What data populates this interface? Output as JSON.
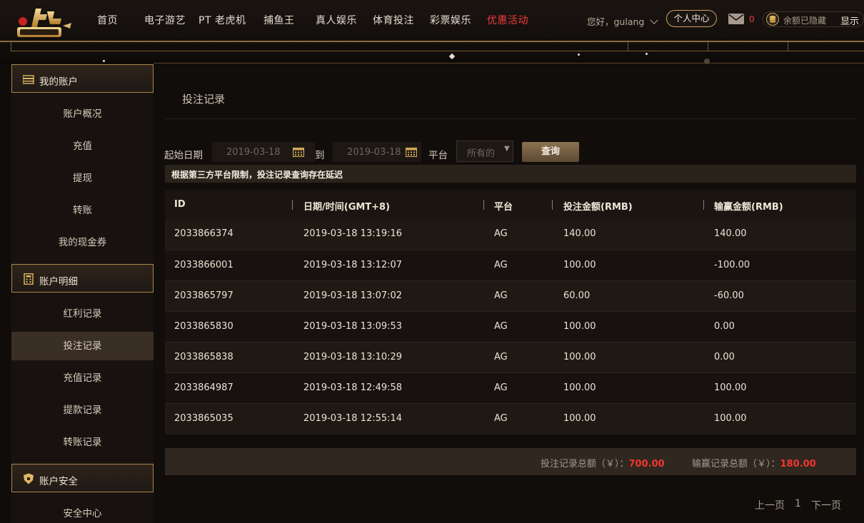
{
  "nav": {
    "items": [
      {
        "label": "首页"
      },
      {
        "label": "电子游艺"
      },
      {
        "label": "PT 老虎机"
      },
      {
        "label": "捕鱼王"
      },
      {
        "label": "真人娱乐"
      },
      {
        "label": "体育投注"
      },
      {
        "label": "彩票娱乐"
      },
      {
        "label": "优惠活动"
      }
    ],
    "greeting": "您好，gulang",
    "center_button": "个人中心",
    "mail_count": "0",
    "balance_hidden": "余额已隐藏",
    "show_label": "显示"
  },
  "sidebar": {
    "sections": [
      {
        "title": "我的账户",
        "items": [
          "账户概况",
          "充值",
          "提现",
          "转账",
          "我的现金券"
        ]
      },
      {
        "title": "账户明细",
        "items": [
          "红利记录",
          "投注记录",
          "充值记录",
          "提款记录",
          "转账记录"
        ]
      },
      {
        "title": "账户安全",
        "items": [
          "安全中心"
        ]
      }
    ],
    "active_item": "投注记录"
  },
  "main": {
    "title": "投注记录",
    "filter": {
      "start_label": "起始日期",
      "start_date": "2019-03-18",
      "to_label": "到",
      "end_date": "2019-03-18",
      "platform_label": "平台",
      "platform_value": "所有的",
      "query_button": "查询"
    },
    "notice": "根据第三方平台限制，投注记录查询存在延迟",
    "table": {
      "headers": [
        "ID",
        "日期/时间(GMT+8)",
        "平台",
        "投注金额(RMB)",
        "输赢金额(RMB)"
      ],
      "rows": [
        [
          "2033866374",
          "2019-03-18 13:19:16",
          "AG",
          "140.00",
          "140.00"
        ],
        [
          "2033866001",
          "2019-03-18 13:12:07",
          "AG",
          "100.00",
          "-100.00"
        ],
        [
          "2033865797",
          "2019-03-18 13:07:02",
          "AG",
          "60.00",
          "-60.00"
        ],
        [
          "2033865830",
          "2019-03-18 13:09:53",
          "AG",
          "100.00",
          "0.00"
        ],
        [
          "2033865838",
          "2019-03-18 13:10:29",
          "AG",
          "100.00",
          "0.00"
        ],
        [
          "2033864987",
          "2019-03-18 12:49:58",
          "AG",
          "100.00",
          "100.00"
        ],
        [
          "2033865035",
          "2019-03-18 12:55:14",
          "AG",
          "100.00",
          "100.00"
        ]
      ]
    },
    "summary": {
      "bet_total_label": "投注记录总额（￥）：",
      "bet_total": "700.00",
      "win_total_label": "输赢记录总额（￥）：",
      "win_total": "180.00"
    },
    "pager": {
      "prev": "上一页",
      "page": "1",
      "next": "下一页"
    }
  },
  "colors": {
    "accent_gold": "#a9844c",
    "promo_red": "#f03c3c",
    "amount_red": "#f0372e"
  }
}
